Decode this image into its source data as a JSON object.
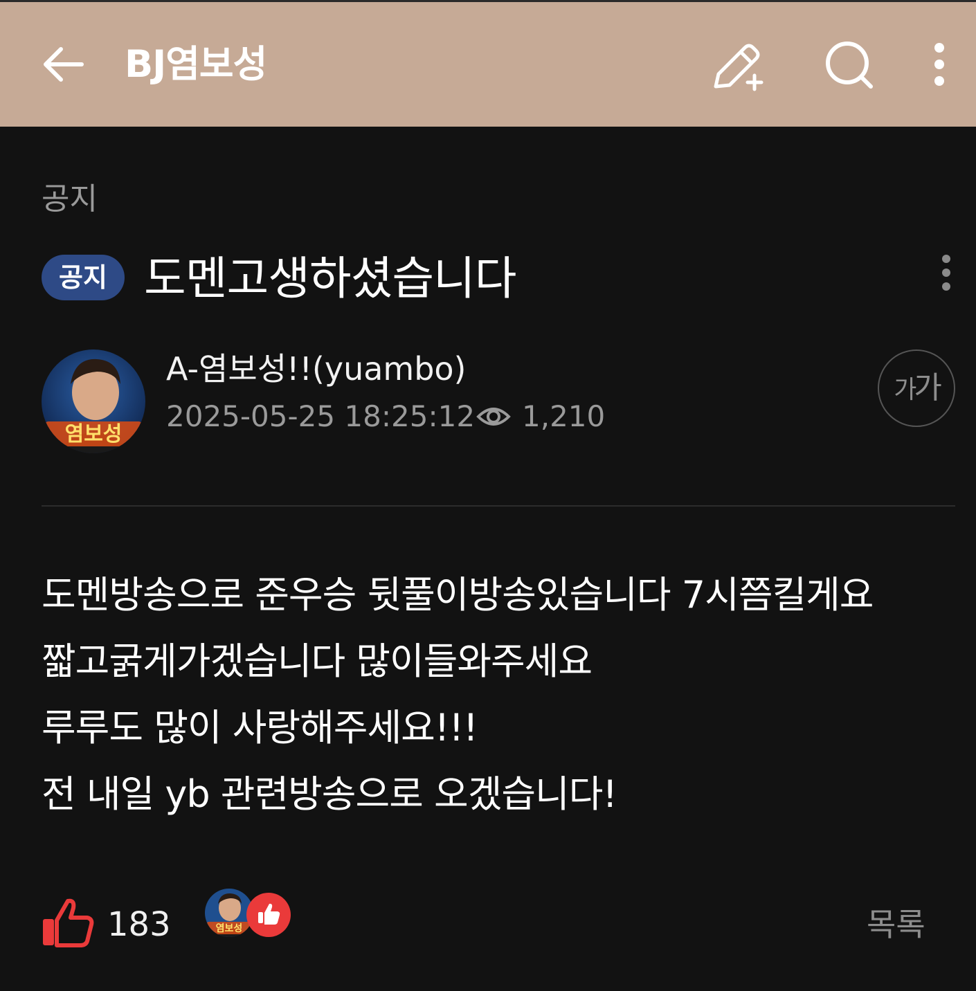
{
  "header": {
    "title": "BJ염보성",
    "icons": [
      "back-arrow-icon",
      "write-post-icon",
      "search-icon",
      "more-vertical-icon"
    ]
  },
  "post": {
    "category": "공지",
    "badge": "공지",
    "title": "도멘고생하셨습니다",
    "author": "A-염보성!!(yuambo)",
    "datetime": "2025-05-25 18:25:12",
    "views": "1,210",
    "avatar_label": "염보성",
    "font_size_small": "가",
    "font_size_large": "가",
    "body_lines": [
      "도멘방송으로 준우승 뒷풀이방송있습니다 7시쯤킬게요",
      "짧고굵게가겠습니다 많이들와주세요",
      "루루도 많이 사랑해주세요!!!",
      "전 내일 yb 관련방송으로 오겠습니다!"
    ]
  },
  "footer": {
    "like_count": "183",
    "liker_avatar_label": "염보성",
    "list_label": "목록"
  },
  "colors": {
    "appbar": "#c6aa96",
    "background": "#121212",
    "badge": "#2e4a86",
    "like": "#ea3a3a"
  }
}
